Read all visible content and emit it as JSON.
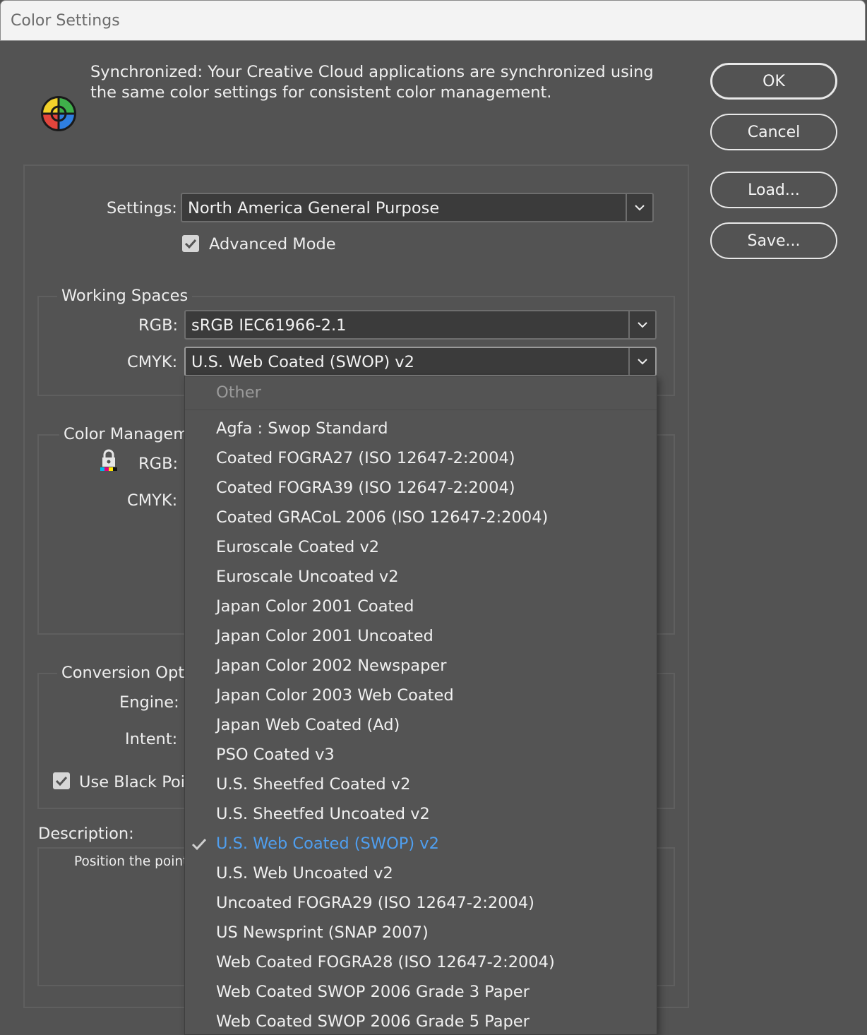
{
  "window": {
    "title": "Color Settings"
  },
  "header": {
    "sync_message": "Synchronized: Your Creative Cloud applications are synchronized using the same color settings for consistent color management."
  },
  "buttons": {
    "ok": "OK",
    "cancel": "Cancel",
    "load": "Load...",
    "save": "Save..."
  },
  "settings": {
    "label": "Settings:",
    "value": "North America General Purpose",
    "advanced_mode_label": "Advanced Mode",
    "advanced_mode_checked": true
  },
  "working_spaces": {
    "title": "Working Spaces",
    "rgb_label": "RGB:",
    "rgb_value": "sRGB IEC61966-2.1",
    "cmyk_label": "CMYK:",
    "cmyk_value": "U.S. Web Coated (SWOP) v2"
  },
  "color_management": {
    "title": "Color Manageme",
    "rgb_label": "RGB:",
    "cmyk_label": "CMYK:"
  },
  "conversion": {
    "title": "Conversion Optio",
    "engine_label": "Engine:",
    "intent_label": "Intent:",
    "black_point_label": "Use Black Poin",
    "black_point_checked": true
  },
  "description": {
    "label": "Description:",
    "text": "Position the point"
  },
  "dropdown": {
    "header": "Other",
    "items": [
      "Agfa : Swop Standard",
      "Coated FOGRA27 (ISO 12647-2:2004)",
      "Coated FOGRA39 (ISO 12647-2:2004)",
      "Coated GRACoL 2006 (ISO 12647-2:2004)",
      "Euroscale Coated v2",
      "Euroscale Uncoated v2",
      "Japan Color 2001 Coated",
      "Japan Color 2001 Uncoated",
      "Japan Color 2002 Newspaper",
      "Japan Color 2003 Web Coated",
      "Japan Web Coated (Ad)",
      "PSO Coated v3",
      "U.S. Sheetfed Coated v2",
      "U.S. Sheetfed Uncoated v2",
      "U.S. Web Coated (SWOP) v2",
      "U.S. Web Uncoated v2",
      "Uncoated FOGRA29 (ISO 12647-2:2004)",
      "US Newsprint (SNAP 2007)",
      "Web Coated FOGRA28 (ISO 12647-2:2004)",
      "Web Coated SWOP 2006 Grade 3 Paper",
      "Web Coated SWOP 2006 Grade 5 Paper"
    ],
    "selected_index": 14,
    "selected_color": "#4f9ff0"
  },
  "icons": {
    "sync": "color-wheel-icon",
    "lock": "lock-icon",
    "check": "checkmark-icon",
    "chevron": "chevron-down-icon"
  }
}
